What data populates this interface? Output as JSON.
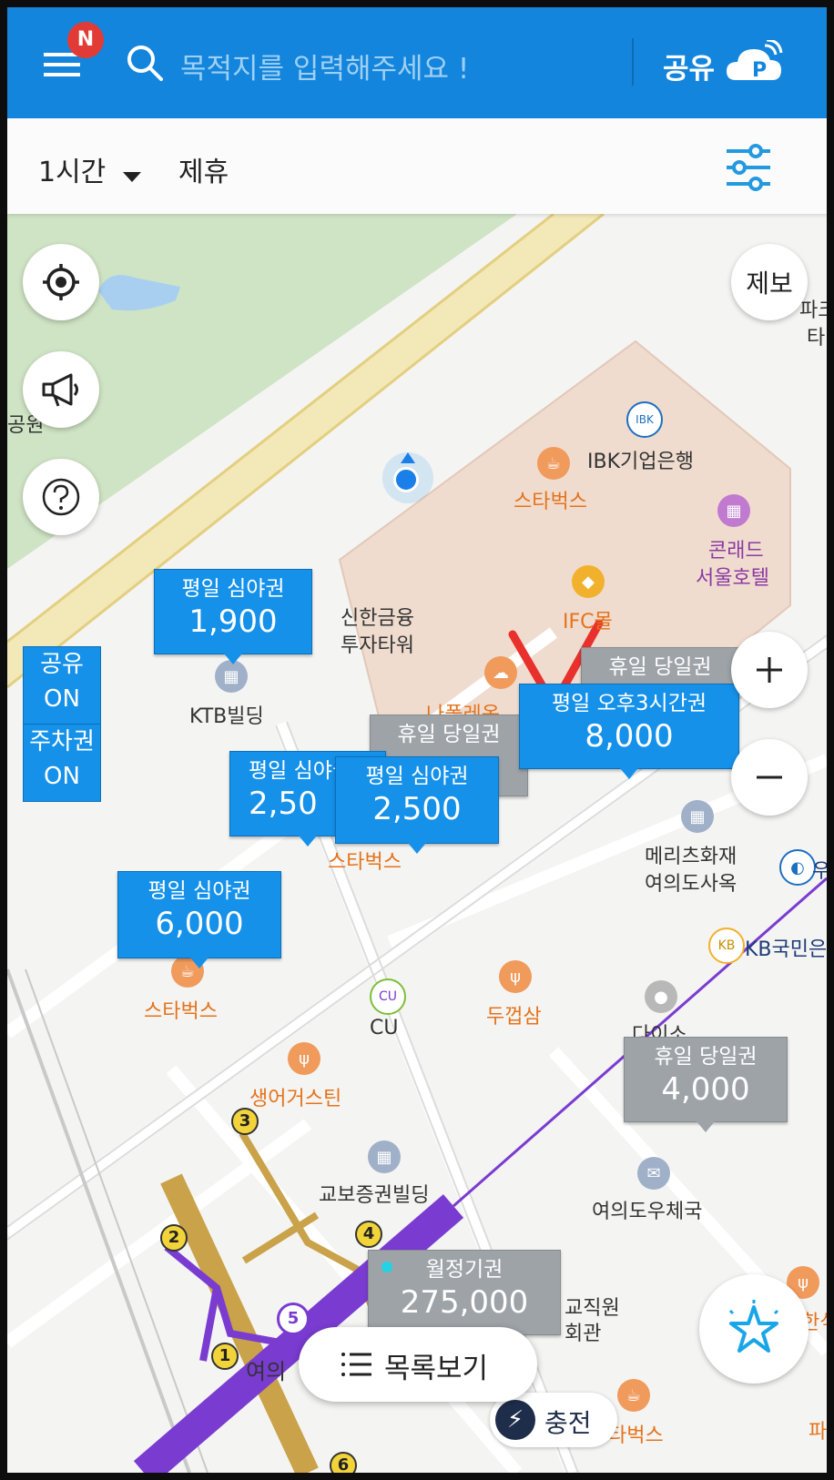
{
  "header": {
    "notification_badge": "N",
    "search_placeholder": "목적지를 입력해주세요 !",
    "share_label": "공유"
  },
  "filters": {
    "duration": "1시간",
    "partner": "제휴"
  },
  "map_buttons": {
    "report": "제보",
    "list_view": "목록보기"
  },
  "toggles": [
    {
      "label": "공유",
      "state": "ON"
    },
    {
      "label": "주차권",
      "state": "ON"
    }
  ],
  "price_tags": [
    {
      "title": "평일 심야권",
      "price": "1,900",
      "color": "blue"
    },
    {
      "title": "휴일 당일권",
      "price": "",
      "color": "grey"
    },
    {
      "title": "평일 오후3시간권",
      "price": "8,000",
      "color": "blue"
    },
    {
      "title": "휴일 당일권",
      "price": "",
      "color": "grey"
    },
    {
      "title": "평일 심야권",
      "price": "2,50",
      "color": "blue"
    },
    {
      "title": "평일 심야권",
      "price": "2,500",
      "color": "blue"
    },
    {
      "title": "평일 심야권",
      "price": "6,000",
      "color": "blue"
    },
    {
      "title": "휴일 당일권",
      "price": "4,000",
      "color": "grey"
    },
    {
      "title": "월정기권",
      "price": "275,000",
      "color": "grey"
    }
  ],
  "pois": {
    "ibk": "IBK기업은행",
    "starbucks1": "스타벅스",
    "conrad_1": "콘래드",
    "conrad_2": "서울호텔",
    "shinhan_1": "신한금융",
    "shinhan_2": "투자타워",
    "ifc": "IFC몰",
    "ktb": "KTB빌딩",
    "napoleon": "나폴레옹",
    "starbucks2": "스타벅스",
    "meritz_1": "메리츠화재",
    "meritz_2": "여의도사옥",
    "woori": "우",
    "kb": "KB국민은",
    "starbucks3": "스타벅스",
    "cu": "CU",
    "dukkeopsam": "두껍삼",
    "daiso": "다이소",
    "saengeo": "생어거스틴",
    "kyobo": "교보증권빌딩",
    "post": "여의도우체국",
    "teachers_1": "교직원",
    "teachers_2": "회관",
    "yeouido": "여의",
    "park_1": "파크",
    "park_2": "타",
    "gongwon": "공원",
    "charge": "충전",
    "starbucks4": "타벅스",
    "hansik": "한식",
    "pa": "파"
  },
  "stations": [
    "1",
    "2",
    "3",
    "4",
    "5",
    "6"
  ],
  "colors": {
    "header_blue": "#1385dd",
    "tag_blue": "#1591ea",
    "tag_grey": "#9ea3a8",
    "line5": "#7a3bd1",
    "line9": "#c9a24a",
    "annotation_red": "#e8302c"
  }
}
